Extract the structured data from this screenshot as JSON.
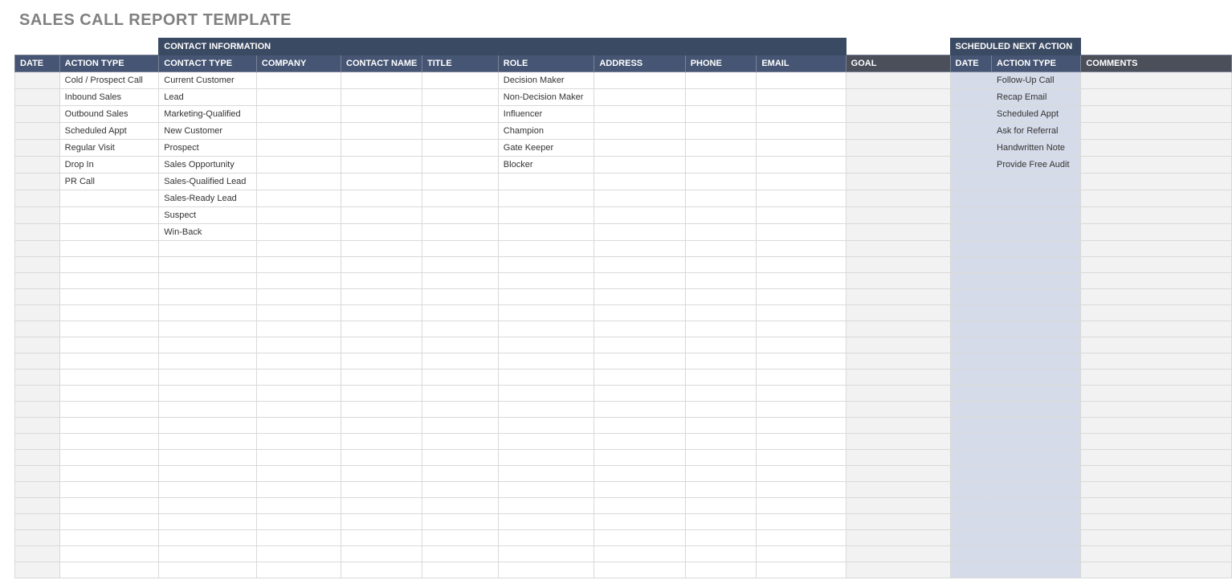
{
  "title": "SALES CALL REPORT TEMPLATE",
  "groups": {
    "contact_info": "CONTACT INFORMATION",
    "scheduled_next": "SCHEDULED NEXT ACTION"
  },
  "headers": {
    "date": "DATE",
    "action_type": "ACTION TYPE",
    "contact_type": "CONTACT TYPE",
    "company": "COMPANY",
    "contact_name": "CONTACT NAME",
    "title": "TITLE",
    "role": "ROLE",
    "address": "ADDRESS",
    "phone": "PHONE",
    "email": "EMAIL",
    "goal": "GOAL",
    "next_date": "DATE",
    "next_action_type": "ACTION TYPE",
    "comments": "COMMENTS"
  },
  "rows": [
    {
      "action_type": "Cold / Prospect Call",
      "contact_type": "Current Customer",
      "role": "Decision Maker",
      "next_action_type": "Follow-Up Call"
    },
    {
      "action_type": "Inbound Sales",
      "contact_type": "Lead",
      "role": "Non-Decision Maker",
      "next_action_type": "Recap Email"
    },
    {
      "action_type": "Outbound Sales",
      "contact_type": "Marketing-Qualified",
      "role": "Influencer",
      "next_action_type": "Scheduled Appt"
    },
    {
      "action_type": "Scheduled Appt",
      "contact_type": "New Customer",
      "role": "Champion",
      "next_action_type": "Ask for Referral"
    },
    {
      "action_type": "Regular Visit",
      "contact_type": "Prospect",
      "role": "Gate Keeper",
      "next_action_type": "Handwritten Note"
    },
    {
      "action_type": "Drop In",
      "contact_type": "Sales Opportunity",
      "role": "Blocker",
      "next_action_type": "Provide Free Audit"
    },
    {
      "action_type": "PR Call",
      "contact_type": "Sales-Qualified Lead",
      "role": "",
      "next_action_type": ""
    },
    {
      "action_type": "",
      "contact_type": "Sales-Ready Lead",
      "role": "",
      "next_action_type": ""
    },
    {
      "action_type": "",
      "contact_type": "Suspect",
      "role": "",
      "next_action_type": ""
    },
    {
      "action_type": "",
      "contact_type": "Win-Back",
      "role": "",
      "next_action_type": ""
    }
  ],
  "total_body_rows": 31
}
